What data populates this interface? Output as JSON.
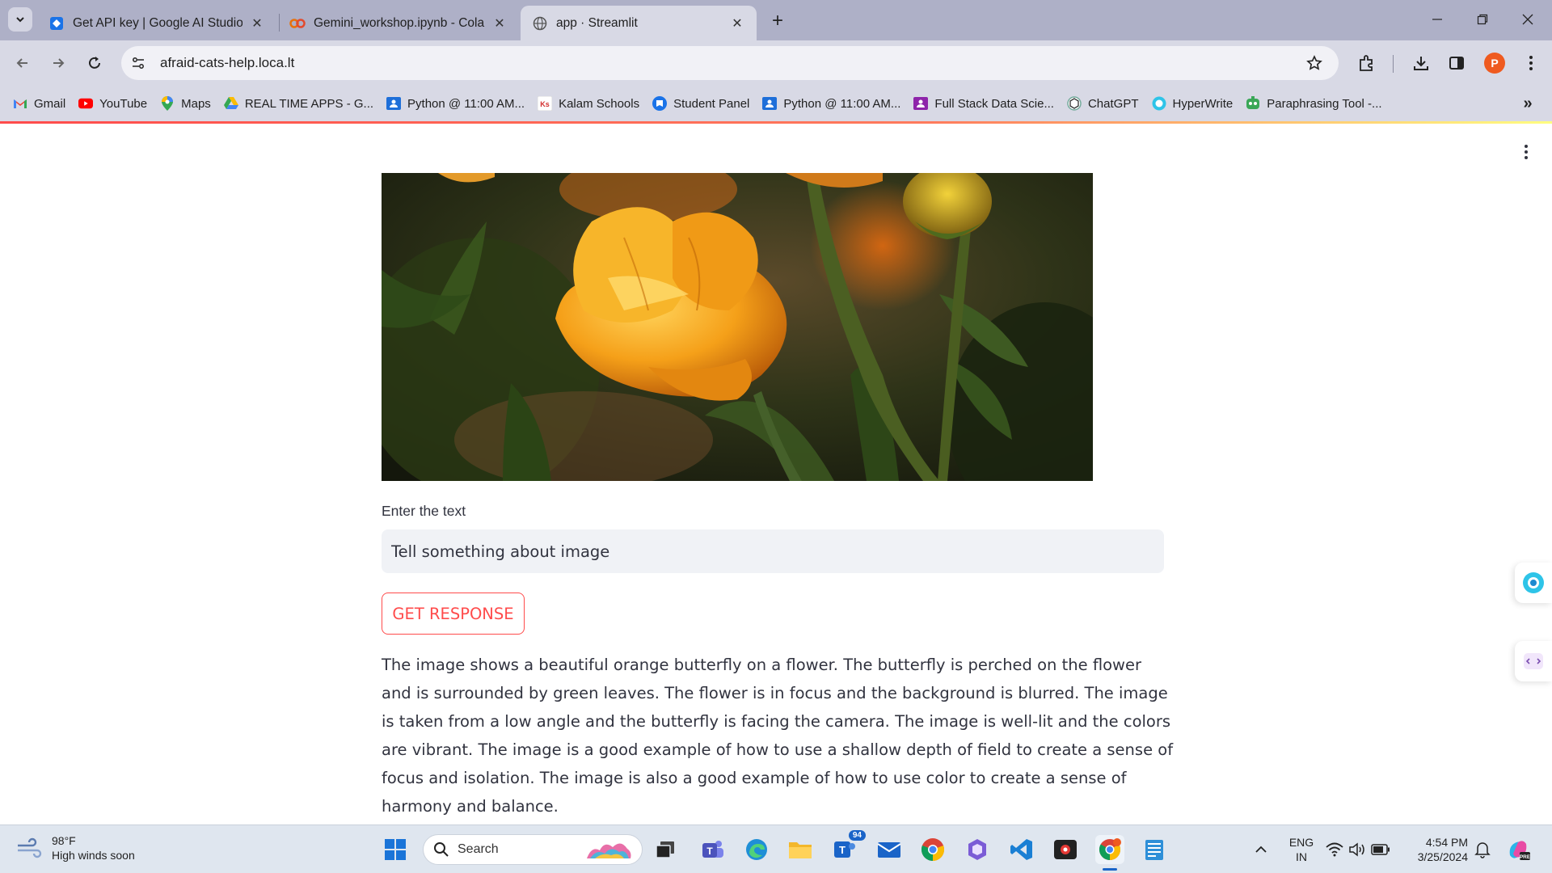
{
  "browser": {
    "tabs": [
      {
        "title": "Get API key | Google AI Studio",
        "favicon": "ai-studio-icon",
        "active": false
      },
      {
        "title": "Gemini_workshop.ipynb - Colab",
        "favicon": "colab-icon",
        "active": false
      },
      {
        "title": "app · Streamlit",
        "favicon": "globe-icon",
        "active": true
      }
    ],
    "close_glyph": "✕",
    "new_tab_glyph": "+",
    "url": "afraid-cats-help.loca.lt",
    "profile_initial": "P",
    "bookmarks": [
      {
        "label": "Gmail",
        "icon": "gmail-icon"
      },
      {
        "label": "YouTube",
        "icon": "youtube-icon"
      },
      {
        "label": "Maps",
        "icon": "maps-icon"
      },
      {
        "label": "REAL TIME APPS - G...",
        "icon": "google-drive-icon"
      },
      {
        "label": "Python @ 11:00 AM...",
        "icon": "classroom-icon"
      },
      {
        "label": "Kalam Schools",
        "icon": "kalam-icon"
      },
      {
        "label": "Student Panel",
        "icon": "student-panel-icon"
      },
      {
        "label": "Python @ 11:00 AM...",
        "icon": "classroom-icon"
      },
      {
        "label": "Full Stack Data Scie...",
        "icon": "classroom-purple-icon"
      },
      {
        "label": "ChatGPT",
        "icon": "chatgpt-icon"
      },
      {
        "label": "HyperWrite",
        "icon": "hyperwrite-icon"
      },
      {
        "label": "Paraphrasing Tool -...",
        "icon": "paraphrasing-icon"
      }
    ],
    "bookmarks_more": "»"
  },
  "app": {
    "image_alt": "orange flower photo",
    "input_label": "Enter the text",
    "input_value": "Tell something about image",
    "button_label": "GET RESPONSE",
    "response_text": "The image shows a beautiful orange butterfly on a flower. The butterfly is perched on the flower and is surrounded by green leaves. The flower is in focus and the background is blurred. The image is taken from a low angle and the butterfly is facing the camera. The image is well-lit and the colors are vibrant. The image is a good example of how to use a shallow depth of field to create a sense of focus and isolation. The image is also a good example of how to use color to create a sense of harmony and balance.",
    "accent_color": "#ff4b4b"
  },
  "taskbar": {
    "weather_temp": "98°F",
    "weather_desc": "High winds soon",
    "search_placeholder": "Search",
    "teams_badge": "94",
    "lang_line1": "ENG",
    "lang_line2": "IN",
    "time": "4:54 PM",
    "date": "3/25/2024"
  }
}
